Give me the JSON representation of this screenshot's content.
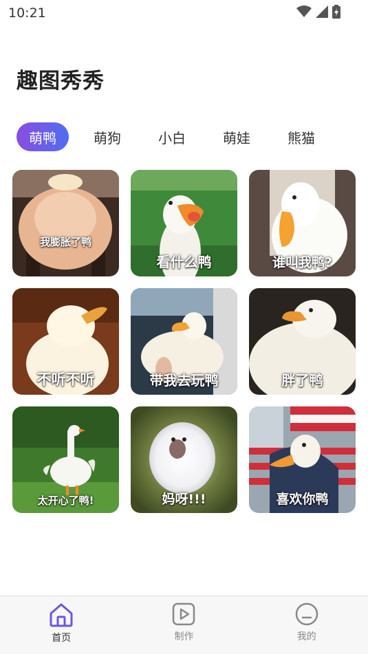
{
  "status_bar": {
    "time": "10:21"
  },
  "page_title": "趣图秀秀",
  "tabs": [
    {
      "label": "萌鸭",
      "active": true
    },
    {
      "label": "萌狗",
      "active": false
    },
    {
      "label": "小白",
      "active": false
    },
    {
      "label": "萌娃",
      "active": false
    },
    {
      "label": "熊猫",
      "active": false
    }
  ],
  "cards": [
    {
      "caption": "我膨胀了鸭"
    },
    {
      "caption": "看什么鸭"
    },
    {
      "caption": "谁叫我鸭?"
    },
    {
      "caption": "不听不听"
    },
    {
      "caption": "带我去玩鸭"
    },
    {
      "caption": "胖了鸭"
    },
    {
      "caption": "太开心了鸭!"
    },
    {
      "caption": "妈呀!!!"
    },
    {
      "caption": "喜欢你鸭"
    }
  ],
  "bottom_nav": [
    {
      "label": "首页",
      "icon": "home-icon",
      "active": true
    },
    {
      "label": "制作",
      "icon": "play-icon",
      "active": false
    },
    {
      "label": "我的",
      "icon": "profile-icon",
      "active": false
    }
  ],
  "colors": {
    "accent_start": "#8a4de0",
    "accent_end": "#4f6df0",
    "nav_active": "#6a56e6"
  }
}
